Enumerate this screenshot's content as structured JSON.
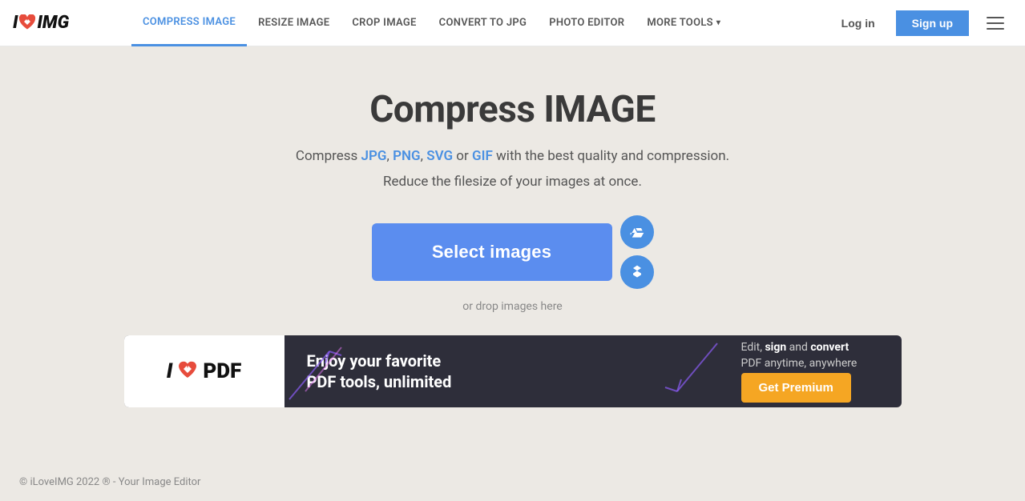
{
  "logo": {
    "text_i": "I",
    "text_img": "IMG"
  },
  "nav": {
    "items": [
      {
        "label": "COMPRESS IMAGE",
        "active": true,
        "key": "compress"
      },
      {
        "label": "RESIZE IMAGE",
        "active": false,
        "key": "resize"
      },
      {
        "label": "CROP IMAGE",
        "active": false,
        "key": "crop"
      },
      {
        "label": "CONVERT TO JPG",
        "active": false,
        "key": "convert"
      },
      {
        "label": "PHOTO EDITOR",
        "active": false,
        "key": "photo"
      },
      {
        "label": "MORE TOOLS",
        "active": false,
        "key": "more",
        "hasChevron": true
      }
    ],
    "login_label": "Log in",
    "signup_label": "Sign up"
  },
  "main": {
    "title": "Compress IMAGE",
    "subtitle_prefix": "Compress ",
    "jpg": "JPG",
    "comma1": ",",
    "png": "PNG",
    "comma2": ",",
    "svg": "SVG",
    "or_text": " or ",
    "gif": "GIF",
    "subtitle_suffix": " with the best quality and compression.",
    "subtitle2": "Reduce the filesize of your images at once.",
    "select_btn": "Select images",
    "drop_text": "or drop images here"
  },
  "ad": {
    "logo_i": "I",
    "logo_pdf": "PDF",
    "tagline_line1": "Enjoy your favorite",
    "tagline_line2": "PDF tools, unlimited",
    "sub_text_prefix": "Edit, ",
    "sub_sign": "sign",
    "sub_text_mid": " and ",
    "sub_convert": "convert",
    "sub_text_suffix": "",
    "sub_line2": "PDF anytime, anywhere",
    "premium_btn": "Get Premium"
  },
  "footer": {
    "text": "© iLoveIMG 2022 ® - Your Image Editor"
  },
  "icons": {
    "gdrive": "▲",
    "dropbox": "⬡",
    "hamburger": "☰"
  }
}
